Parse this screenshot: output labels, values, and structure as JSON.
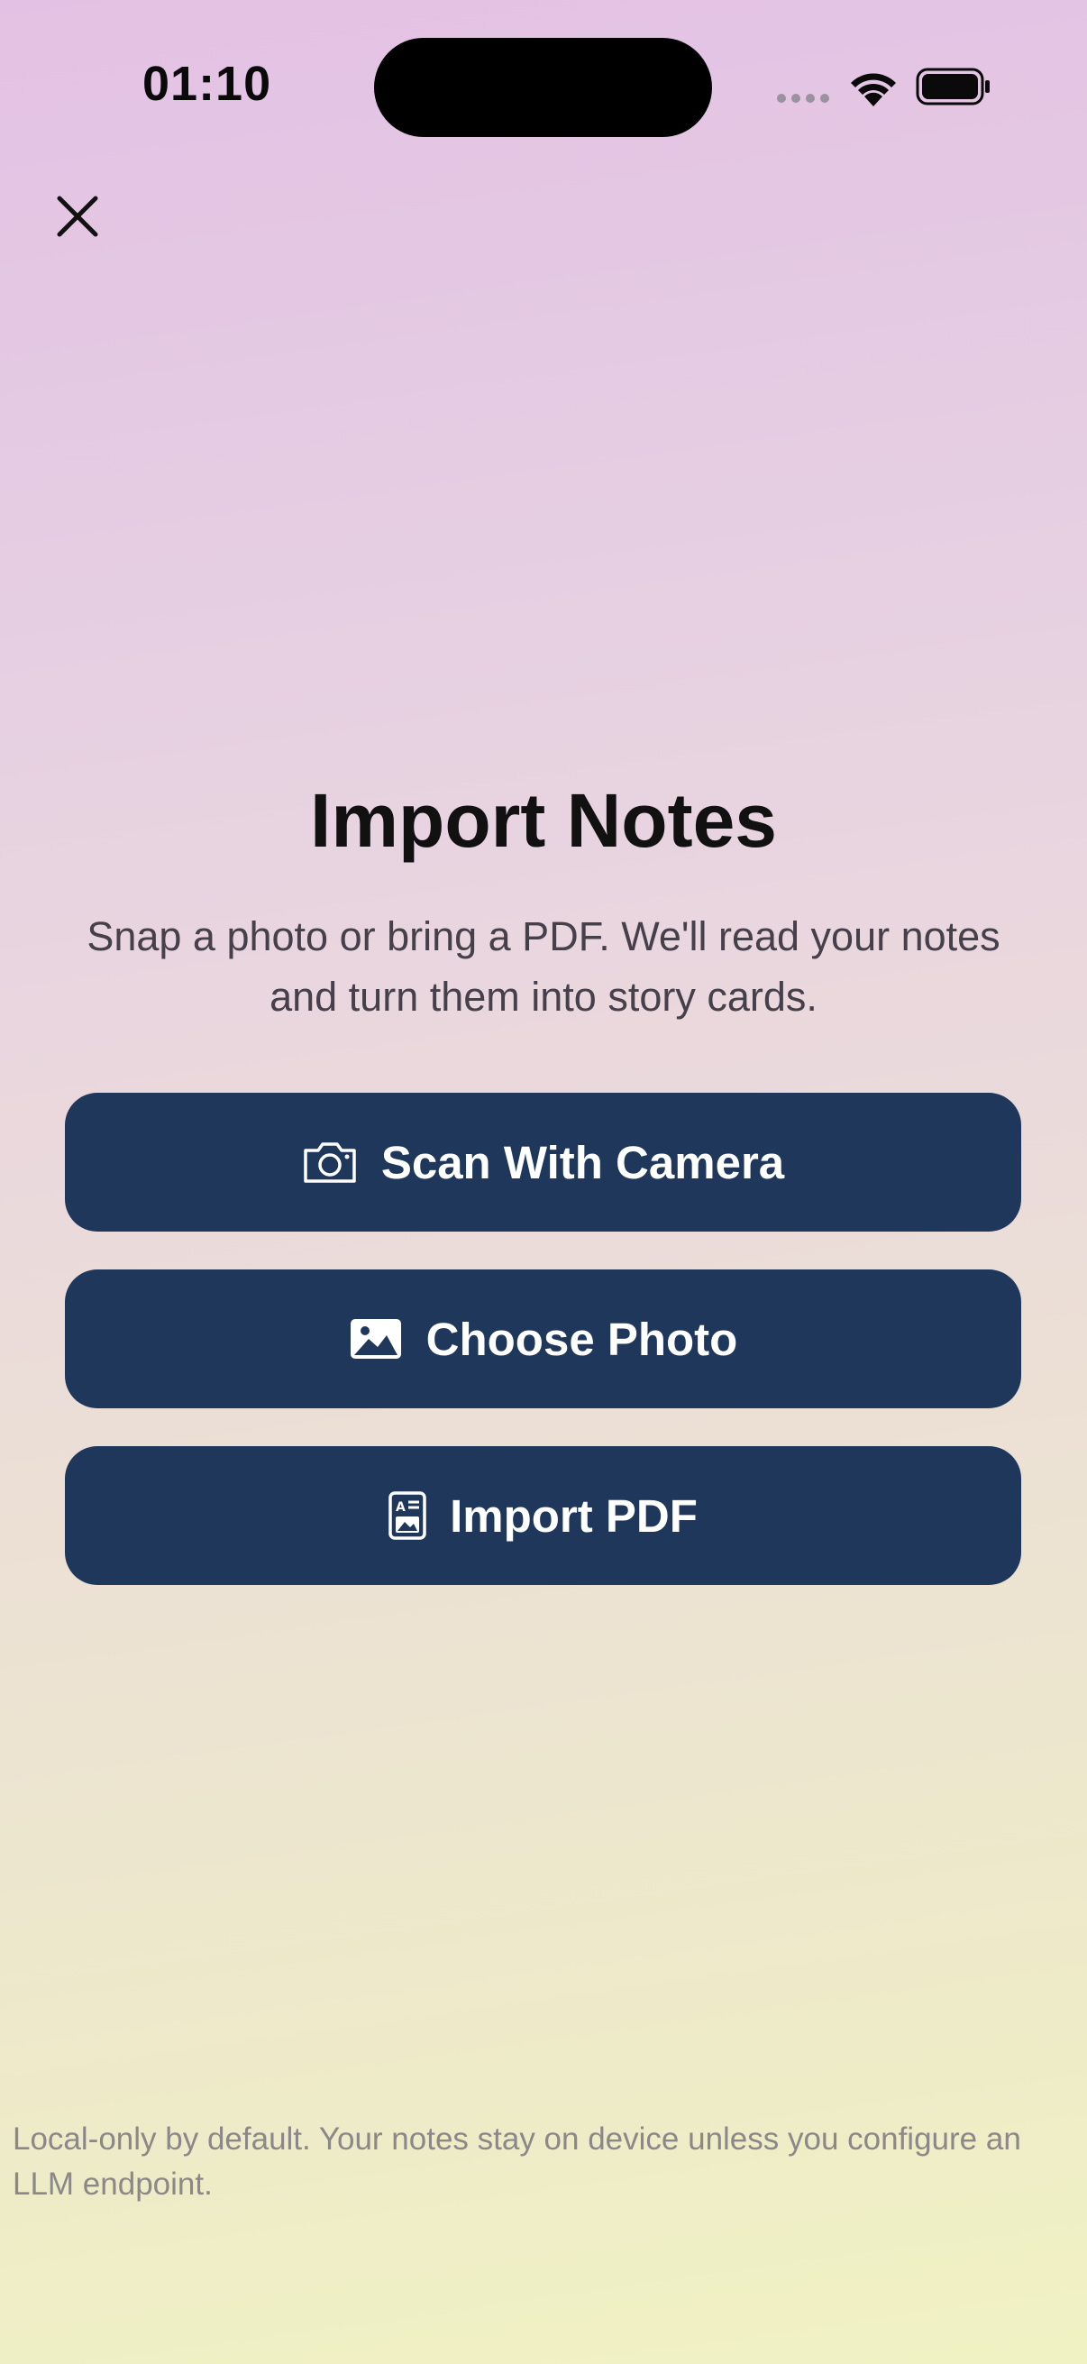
{
  "status_bar": {
    "time": "01:10"
  },
  "main": {
    "title": "Import Notes",
    "subtitle": "Snap a photo or bring a PDF. We'll read your notes and turn them into story cards."
  },
  "actions": {
    "scan_label": "Scan With Camera",
    "photo_label": "Choose Photo",
    "pdf_label": "Import PDF"
  },
  "footer": {
    "note": "Local-only by default. Your notes stay on device unless you configure an LLM endpoint."
  },
  "icons": {
    "close": "close-icon",
    "scan": "camera-icon",
    "photo": "photo-icon",
    "pdf": "document-icon"
  },
  "colors": {
    "button_bg": "#1e375b",
    "button_text": "#ffffff"
  }
}
